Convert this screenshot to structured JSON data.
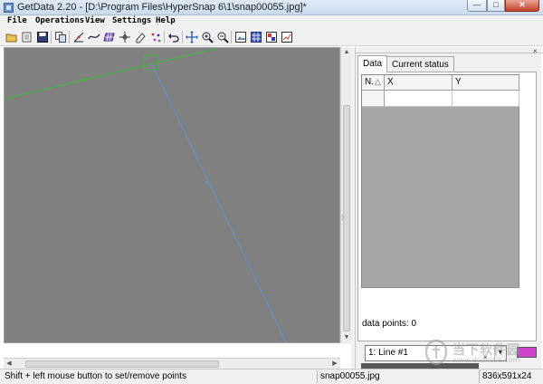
{
  "window": {
    "title": "GetData 2.20 - [D:\\Program Files\\HyperSnap 6\\1\\snap00055.jpg]*",
    "min_label": "—",
    "max_label": "□",
    "close_label": "✕"
  },
  "menu": [
    "File",
    "Operations",
    "View",
    "Settings",
    "Help"
  ],
  "toolbar": {
    "icons": [
      "open-file-icon",
      "open-folder-icon",
      "save-icon",
      "copy-icon",
      "axis-icon",
      "line-digitize-icon",
      "grid-digitize-icon",
      "points-icon",
      "eraser-icon",
      "point-capture-icon",
      "undo-icon",
      "move-icon",
      "zoom-in-icon",
      "zoom-out-icon",
      "image-icon",
      "grid-icon",
      "color-picker-icon",
      "chart-icon"
    ]
  },
  "panel": {
    "close_glyph": "×",
    "tabs": [
      {
        "label": "Data",
        "active": true
      },
      {
        "label": "Current status",
        "active": false
      }
    ],
    "table": {
      "columns": [
        "N.",
        "X",
        "Y"
      ],
      "sort_indicator": "△",
      "rows": []
    },
    "data_points": "data points: 0",
    "line_select": {
      "value": "1: Line #1"
    },
    "line_color": "#cc44cc"
  },
  "status": {
    "hint": "Shift + left mouse button to set/remove points",
    "filename": "snap00055.jpg",
    "image_info": "836x591x24"
  },
  "canvas": {
    "background": "#808080",
    "green_line_color": "#3bb83b",
    "blue_line_color": "#5b8fd6"
  },
  "watermark": {
    "text": "当下软件园",
    "sub": "www.downxia.com"
  }
}
